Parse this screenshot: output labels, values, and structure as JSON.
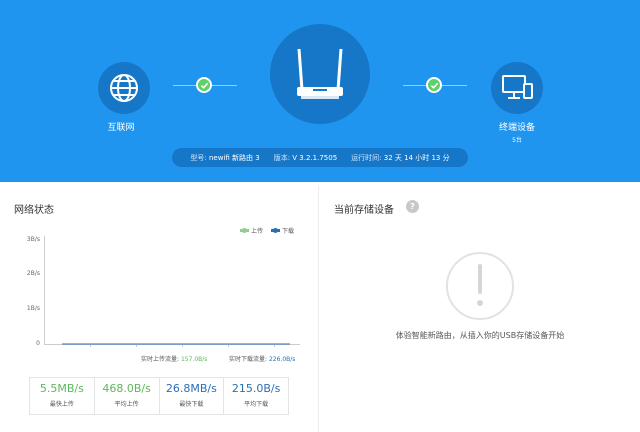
{
  "topology": {
    "internet_label": "互联网",
    "terminal_label": "终端设备",
    "terminal_count": "5台"
  },
  "router_info": {
    "model_key": "型号:",
    "model_value": "newifi 新路由 3",
    "version_key": "版本:",
    "version_value": "V 3.2.1.7505",
    "uptime_key": "运行时间:",
    "uptime_value": "32 天 14 小时 13 分"
  },
  "network_status": {
    "title": "网络状态",
    "legend": {
      "up": "上传",
      "down": "下载"
    },
    "realtime": {
      "up_label": "实时上传流量:",
      "up_value": "157.0B/s",
      "down_label": "实时下载流量:",
      "down_value": "226.0B/s"
    },
    "stats": [
      {
        "value": "5.5MB/s",
        "label": "最快上传"
      },
      {
        "value": "468.0B/s",
        "label": "平均上传"
      },
      {
        "value": "26.8MB/s",
        "label": "最快下载"
      },
      {
        "value": "215.0B/s",
        "label": "平均下载"
      }
    ]
  },
  "chart_data": {
    "type": "line",
    "y_ticks": [
      "3B/s",
      "2B/s",
      "1B/s",
      "0"
    ],
    "ylim": [
      0,
      3
    ],
    "series": [
      {
        "name": "上传",
        "color": "#8fd08f",
        "values": [
          0,
          0,
          0,
          0,
          0,
          0,
          0,
          0,
          0,
          0,
          0,
          0
        ]
      },
      {
        "name": "下载",
        "color": "#2a6fb5",
        "values": [
          0,
          0,
          0,
          0,
          0,
          0,
          0,
          0,
          0,
          0,
          0,
          0
        ]
      }
    ],
    "grid": false,
    "legend_position": "top-right"
  },
  "storage": {
    "title": "当前存储设备",
    "help_icon": "?",
    "message": "体验智能新路由，从插入你的USB存储设备开始"
  },
  "colors": {
    "hero_bg": "#1f95f0",
    "node_bg": "#1677c9",
    "ok_green": "#5fd06a"
  }
}
